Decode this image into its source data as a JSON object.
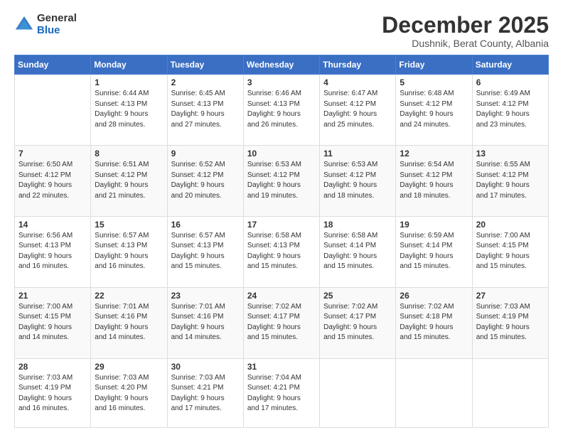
{
  "logo": {
    "general": "General",
    "blue": "Blue"
  },
  "title": "December 2025",
  "subtitle": "Dushnik, Berat County, Albania",
  "days_of_week": [
    "Sunday",
    "Monday",
    "Tuesday",
    "Wednesday",
    "Thursday",
    "Friday",
    "Saturday"
  ],
  "weeks": [
    [
      {
        "day": "",
        "info": ""
      },
      {
        "day": "1",
        "info": "Sunrise: 6:44 AM\nSunset: 4:13 PM\nDaylight: 9 hours\nand 28 minutes."
      },
      {
        "day": "2",
        "info": "Sunrise: 6:45 AM\nSunset: 4:13 PM\nDaylight: 9 hours\nand 27 minutes."
      },
      {
        "day": "3",
        "info": "Sunrise: 6:46 AM\nSunset: 4:13 PM\nDaylight: 9 hours\nand 26 minutes."
      },
      {
        "day": "4",
        "info": "Sunrise: 6:47 AM\nSunset: 4:12 PM\nDaylight: 9 hours\nand 25 minutes."
      },
      {
        "day": "5",
        "info": "Sunrise: 6:48 AM\nSunset: 4:12 PM\nDaylight: 9 hours\nand 24 minutes."
      },
      {
        "day": "6",
        "info": "Sunrise: 6:49 AM\nSunset: 4:12 PM\nDaylight: 9 hours\nand 23 minutes."
      }
    ],
    [
      {
        "day": "7",
        "info": "Sunrise: 6:50 AM\nSunset: 4:12 PM\nDaylight: 9 hours\nand 22 minutes."
      },
      {
        "day": "8",
        "info": "Sunrise: 6:51 AM\nSunset: 4:12 PM\nDaylight: 9 hours\nand 21 minutes."
      },
      {
        "day": "9",
        "info": "Sunrise: 6:52 AM\nSunset: 4:12 PM\nDaylight: 9 hours\nand 20 minutes."
      },
      {
        "day": "10",
        "info": "Sunrise: 6:53 AM\nSunset: 4:12 PM\nDaylight: 9 hours\nand 19 minutes."
      },
      {
        "day": "11",
        "info": "Sunrise: 6:53 AM\nSunset: 4:12 PM\nDaylight: 9 hours\nand 18 minutes."
      },
      {
        "day": "12",
        "info": "Sunrise: 6:54 AM\nSunset: 4:12 PM\nDaylight: 9 hours\nand 18 minutes."
      },
      {
        "day": "13",
        "info": "Sunrise: 6:55 AM\nSunset: 4:12 PM\nDaylight: 9 hours\nand 17 minutes."
      }
    ],
    [
      {
        "day": "14",
        "info": "Sunrise: 6:56 AM\nSunset: 4:13 PM\nDaylight: 9 hours\nand 16 minutes."
      },
      {
        "day": "15",
        "info": "Sunrise: 6:57 AM\nSunset: 4:13 PM\nDaylight: 9 hours\nand 16 minutes."
      },
      {
        "day": "16",
        "info": "Sunrise: 6:57 AM\nSunset: 4:13 PM\nDaylight: 9 hours\nand 15 minutes."
      },
      {
        "day": "17",
        "info": "Sunrise: 6:58 AM\nSunset: 4:13 PM\nDaylight: 9 hours\nand 15 minutes."
      },
      {
        "day": "18",
        "info": "Sunrise: 6:58 AM\nSunset: 4:14 PM\nDaylight: 9 hours\nand 15 minutes."
      },
      {
        "day": "19",
        "info": "Sunrise: 6:59 AM\nSunset: 4:14 PM\nDaylight: 9 hours\nand 15 minutes."
      },
      {
        "day": "20",
        "info": "Sunrise: 7:00 AM\nSunset: 4:15 PM\nDaylight: 9 hours\nand 15 minutes."
      }
    ],
    [
      {
        "day": "21",
        "info": "Sunrise: 7:00 AM\nSunset: 4:15 PM\nDaylight: 9 hours\nand 14 minutes."
      },
      {
        "day": "22",
        "info": "Sunrise: 7:01 AM\nSunset: 4:16 PM\nDaylight: 9 hours\nand 14 minutes."
      },
      {
        "day": "23",
        "info": "Sunrise: 7:01 AM\nSunset: 4:16 PM\nDaylight: 9 hours\nand 14 minutes."
      },
      {
        "day": "24",
        "info": "Sunrise: 7:02 AM\nSunset: 4:17 PM\nDaylight: 9 hours\nand 15 minutes."
      },
      {
        "day": "25",
        "info": "Sunrise: 7:02 AM\nSunset: 4:17 PM\nDaylight: 9 hours\nand 15 minutes."
      },
      {
        "day": "26",
        "info": "Sunrise: 7:02 AM\nSunset: 4:18 PM\nDaylight: 9 hours\nand 15 minutes."
      },
      {
        "day": "27",
        "info": "Sunrise: 7:03 AM\nSunset: 4:19 PM\nDaylight: 9 hours\nand 15 minutes."
      }
    ],
    [
      {
        "day": "28",
        "info": "Sunrise: 7:03 AM\nSunset: 4:19 PM\nDaylight: 9 hours\nand 16 minutes."
      },
      {
        "day": "29",
        "info": "Sunrise: 7:03 AM\nSunset: 4:20 PM\nDaylight: 9 hours\nand 16 minutes."
      },
      {
        "day": "30",
        "info": "Sunrise: 7:03 AM\nSunset: 4:21 PM\nDaylight: 9 hours\nand 17 minutes."
      },
      {
        "day": "31",
        "info": "Sunrise: 7:04 AM\nSunset: 4:21 PM\nDaylight: 9 hours\nand 17 minutes."
      },
      {
        "day": "",
        "info": ""
      },
      {
        "day": "",
        "info": ""
      },
      {
        "day": "",
        "info": ""
      }
    ]
  ]
}
